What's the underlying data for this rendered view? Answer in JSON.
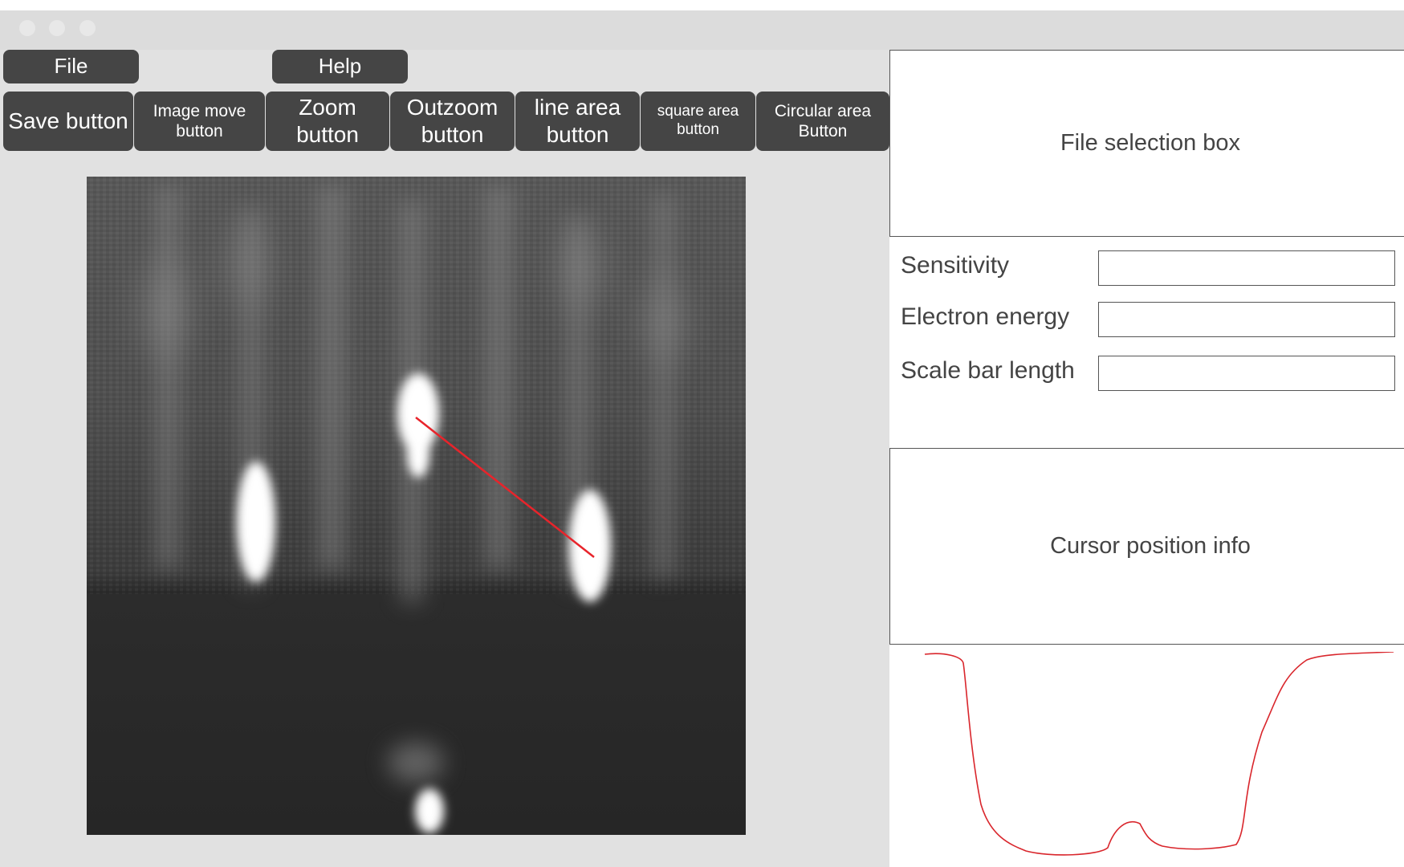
{
  "menu": {
    "file_label": "File",
    "help_label": "Help"
  },
  "toolbar": {
    "save": "Save button",
    "image_move": "Image move button",
    "zoom": "Zoom button",
    "outzoom": "Outzoom button",
    "line_area": "line area button",
    "square_area": "square area button",
    "circular_area": "Circular area Button"
  },
  "file_selection": {
    "label": "File selection box"
  },
  "fields": {
    "sensitivity": {
      "label": "Sensitivity",
      "value": ""
    },
    "electron_energy": {
      "label": "Electron energy",
      "value": ""
    },
    "scale_bar_length": {
      "label": "Scale bar length",
      "value": ""
    }
  },
  "cursor_info": {
    "label": "Cursor position info"
  },
  "colors": {
    "button_bg": "#454545",
    "window_bg": "#e1e1e1",
    "measure_line": "#e8242b",
    "profile_line": "#d9262c"
  },
  "icons": {
    "window_controls": [
      "window-close-dot",
      "window-minimize-dot",
      "window-zoom-dot"
    ]
  }
}
